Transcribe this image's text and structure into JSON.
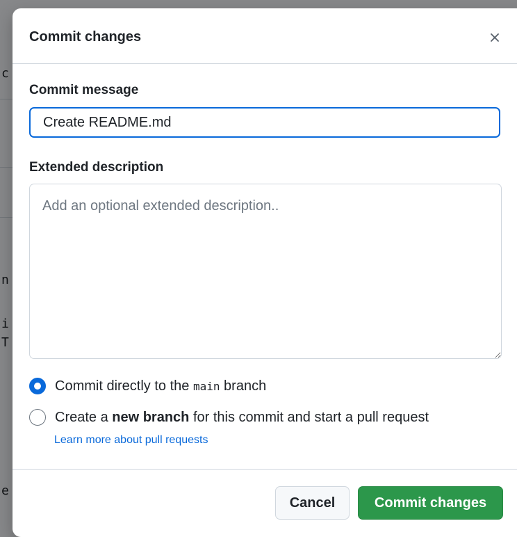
{
  "dialog": {
    "title": "Commit changes",
    "close_icon": "x-icon"
  },
  "commit_message": {
    "label": "Commit message",
    "value": "Create README.md"
  },
  "extended_description": {
    "label": "Extended description",
    "placeholder": "Add an optional extended description.."
  },
  "branch_options": {
    "direct": {
      "prefix": "Commit directly to the ",
      "branch": "main",
      "suffix": " branch",
      "selected": true
    },
    "new_branch": {
      "prefix": "Create a ",
      "emphasis": "new branch",
      "suffix": " for this commit and start a pull request",
      "selected": false
    },
    "learn_more": "Learn more about pull requests"
  },
  "footer": {
    "cancel_label": "Cancel",
    "commit_label": "Commit changes"
  },
  "colors": {
    "accent": "#0969da",
    "primary_button": "#2c974b",
    "border": "#d0d7de"
  }
}
